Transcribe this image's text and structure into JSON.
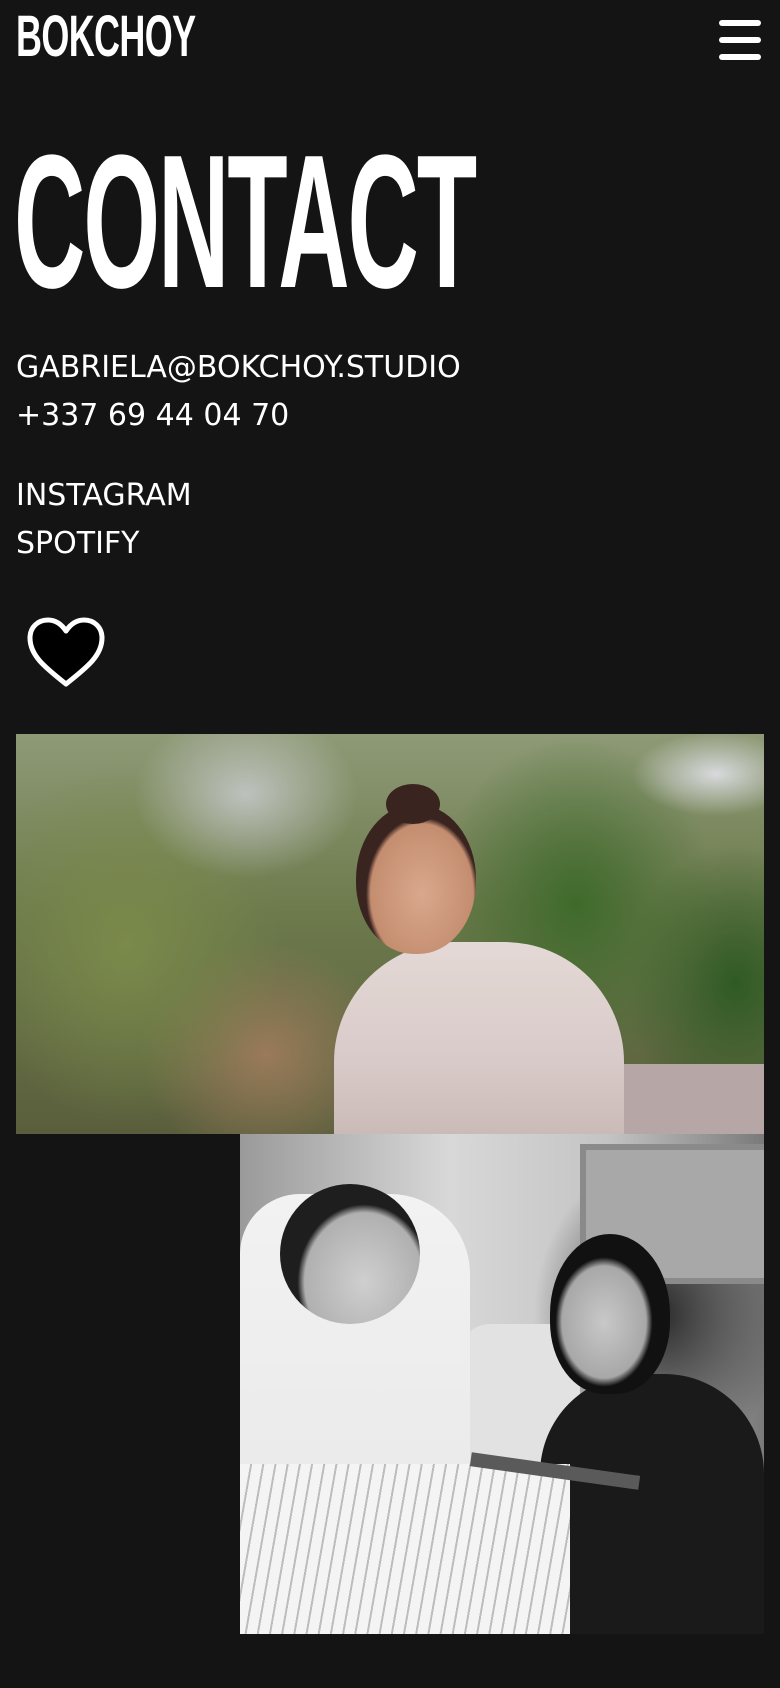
{
  "header": {
    "logo_text": "BOKCHOY",
    "menu_icon": "hamburger-menu-icon"
  },
  "main": {
    "title": "CONTACT",
    "email": "GABRIELA@BOKCHOY.STUDIO",
    "phone": "+337 69 44 04 70",
    "social": {
      "instagram": "INSTAGRAM",
      "spotify": "SPOTIFY"
    },
    "heart_icon": "heart-outline-icon"
  },
  "colors": {
    "background": "#141414",
    "text": "#ffffff"
  }
}
